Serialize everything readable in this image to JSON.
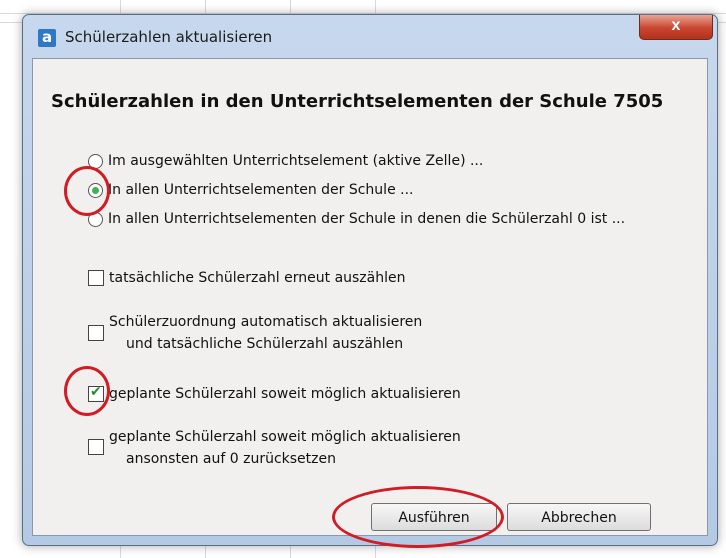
{
  "window": {
    "title": "Schülerzahlen aktualisieren",
    "app_icon": "a",
    "close_glyph": "x"
  },
  "dialog": {
    "heading": "Schülerzahlen in den Unterrichtselementen der Schule 7505",
    "radios": [
      {
        "label": "Im ausgewählten Unterrichtselement (aktive Zelle) ...",
        "checked": false
      },
      {
        "label": "In allen Unterrichtselementen der Schule ...",
        "checked": true
      },
      {
        "label": "In allen Unterrichtselementen der Schule in denen die Schülerzahl 0 ist ...",
        "checked": false
      }
    ],
    "checkboxes": [
      {
        "label": "tatsächliche Schülerzahl erneut auszählen",
        "line2": "",
        "checked": false
      },
      {
        "label": "Schülerzuordnung automatisch aktualisieren",
        "line2": "und tatsächliche Schülerzahl auszählen",
        "checked": false
      },
      {
        "label": "geplante Schülerzahl soweit möglich aktualisieren",
        "line2": "",
        "checked": true
      },
      {
        "label": "geplante Schülerzahl soweit möglich aktualisieren",
        "line2": "ansonsten auf 0 zurücksetzen",
        "checked": false
      }
    ],
    "buttons": {
      "execute": "Ausführen",
      "cancel": "Abbrechen"
    }
  },
  "colors": {
    "annotation": "#d01c24",
    "radio_selected": "#3cb44b",
    "check": "#1f8f2f"
  }
}
